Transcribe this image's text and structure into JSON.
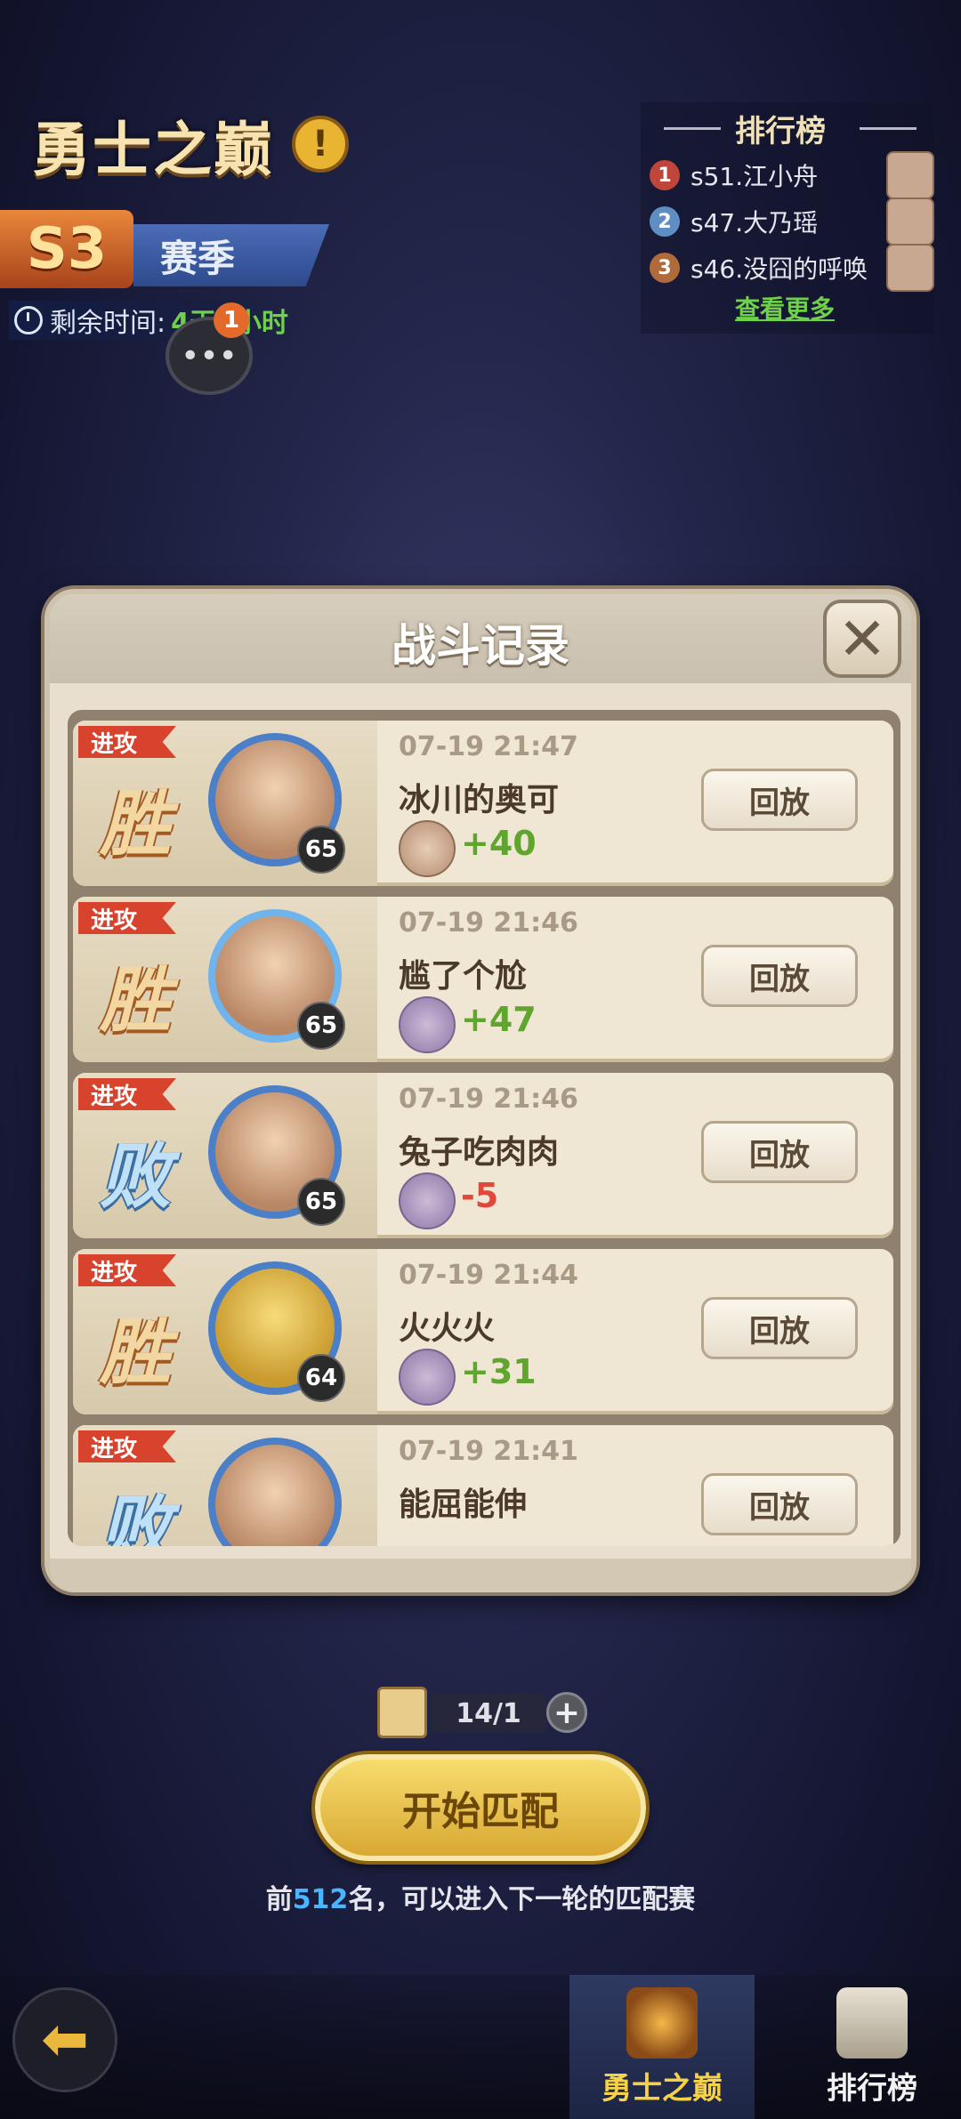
{
  "header": {
    "title": "勇士之巅",
    "info_glyph": "!",
    "season_code": "S3",
    "season_label": "赛季",
    "time_label": "剩余时间:",
    "time_value": "4天3小时",
    "chat_badge_count": "1"
  },
  "leaderboard": {
    "title": "排行榜",
    "entries": [
      {
        "rank": "1",
        "name": "s51.江小舟"
      },
      {
        "rank": "2",
        "name": "s47.大乃瑶"
      },
      {
        "rank": "3",
        "name": "s46.没囧的呼唤"
      }
    ],
    "more_link": "查看更多"
  },
  "battle_log": {
    "title": "战斗记录",
    "close_glyph": "✕",
    "records": [
      {
        "tag": "进攻",
        "result": "胜",
        "level": "65",
        "time": "07-19 21:47",
        "name": "冰川的奥可",
        "delta": "+40",
        "replay": "回放"
      },
      {
        "tag": "进攻",
        "result": "胜",
        "level": "65",
        "time": "07-19 21:46",
        "name": "尴了个尬",
        "delta": "+47",
        "replay": "回放"
      },
      {
        "tag": "进攻",
        "result": "败",
        "level": "65",
        "time": "07-19 21:46",
        "name": "兔子吃肉肉",
        "delta": "-5",
        "replay": "回放"
      },
      {
        "tag": "进攻",
        "result": "胜",
        "level": "64",
        "time": "07-19 21:44",
        "name": "火火火",
        "delta": "+31",
        "replay": "回放"
      },
      {
        "tag": "进攻",
        "result": "败",
        "level": "",
        "time": "07-19 21:41",
        "name": "能屈能伸",
        "delta": "",
        "replay": "回放"
      }
    ]
  },
  "match": {
    "tickets": "14/1",
    "plus_glyph": "+",
    "start_button": "开始匹配",
    "tip_prefix": "前",
    "tip_number": "512",
    "tip_suffix": "名，可以进入下一轮的匹配赛"
  },
  "nav": {
    "back_glyph": "⬅",
    "tab_peak": "勇士之巅",
    "tab_rank": "排行榜"
  },
  "colors": {
    "win": "#f2d7a3",
    "lose": "#bfe0f7",
    "positive": "#5fa52e",
    "negative": "#e0483c",
    "highlight": "#4ab5ff"
  }
}
